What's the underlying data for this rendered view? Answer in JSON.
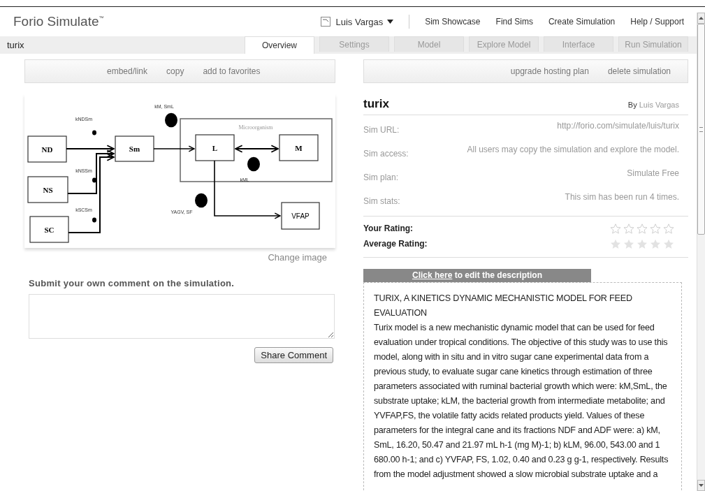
{
  "header": {
    "logo": "Forio Simulate",
    "logo_mark": "™",
    "user": "Luis Vargas",
    "nav": [
      "Sim Showcase",
      "Find Sims",
      "Create Simulation",
      "Help / Support"
    ]
  },
  "sim_name": "turix",
  "tabs": [
    {
      "label": "Overview",
      "selected": true
    },
    {
      "label": "Settings",
      "selected": false
    },
    {
      "label": "Model",
      "selected": false
    },
    {
      "label": "Explore Model",
      "selected": false
    },
    {
      "label": "Interface",
      "selected": false
    },
    {
      "label": "Run Simulation",
      "selected": false
    }
  ],
  "left_actions": [
    "embed/link",
    "copy",
    "add to favorites"
  ],
  "right_actions": [
    "upgrade hosting plan",
    "delete simulation"
  ],
  "figure": {
    "nodes": [
      "ND",
      "NS",
      "SC",
      "Sm",
      "L",
      "M",
      "VFAP"
    ],
    "frame_label": "Microorganism",
    "rate_labels": [
      "kNDSm",
      "kNSSm",
      "kSCSm",
      "kM, SmL",
      "kML",
      "YAGV, SF"
    ]
  },
  "change_image": "Change image",
  "comment": {
    "prompt": "Submit your own comment on the simulation.",
    "button": "Share Comment"
  },
  "info": {
    "title": "turix",
    "by": "By",
    "author": "Luis Vargas",
    "fields": [
      {
        "label": "Sim URL:",
        "value": "http://forio.com/simulate/luis/turix"
      },
      {
        "label": "Sim access:",
        "value": "All users may copy the simulation and explore the model."
      },
      {
        "label": "Sim plan:",
        "value": "Simulate Free"
      },
      {
        "label": "Sim stats:",
        "value": "This sim has been run 4 times."
      }
    ],
    "ratings": [
      {
        "label": "Your Rating:",
        "kind": "outline",
        "stars": 0
      },
      {
        "label": "Average Rating:",
        "kind": "solid",
        "stars": 0
      }
    ]
  },
  "edit_bar": {
    "link": "Click here",
    "rest": " to edit the description"
  },
  "description": {
    "heading": "TURIX, A KINETICS DYNAMIC MECHANISTIC MODEL FOR FEED EVALUATION",
    "body": "Turix model is a new mechanistic dynamic model that can be used for feed evaluation under tropical conditions. The objective of this study was to use this model, along with in situ and in vitro sugar cane experimental data from a previous study, to evaluate sugar cane kinetics through estimation of three parameters associated with ruminal bacterial growth which were: kM,SmL, the substrate uptake; kLM, the bacterial growth from intermediate metabolite; and YVFAP,FS, the volatile fatty acids related products yield. Values of these parameters for the integral cane and its fractions NDF and ADF were: a) kM, SmL, 16.20, 50.47 and 21.97 mL h-1 (mg M)-1; b) kLM, 96.00, 543.00 and 1 680.00 h-1; and c) YVFAP, FS, 1.02, 0.40 and 0.23 g g-1, respectively. Results from the model adjustment showed a slow microbial substrate uptake and a"
  }
}
